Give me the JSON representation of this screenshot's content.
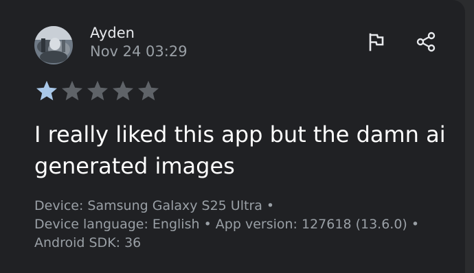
{
  "review": {
    "author": "Ayden",
    "date": "Nov 24 03:29",
    "rating": 1,
    "max_rating": 5,
    "text": "I really liked this app but the damn ai generated images",
    "meta_line1": "Device: Samsung Galaxy S25 Ultra •",
    "meta_line2": "Device language: English • App version: 127618 (13.6.0) •",
    "meta_line3": "Android SDK: 36"
  },
  "icons": {
    "flag": "flag-icon",
    "share": "share-icon",
    "star_filled": "star-filled-icon",
    "star_empty": "star-empty-icon"
  },
  "colors": {
    "star_filled": "#a8c7e8",
    "star_empty": "#5f6368",
    "card_bg": "#202124",
    "text_primary": "#ffffff",
    "text_secondary": "#9aa0a6"
  }
}
